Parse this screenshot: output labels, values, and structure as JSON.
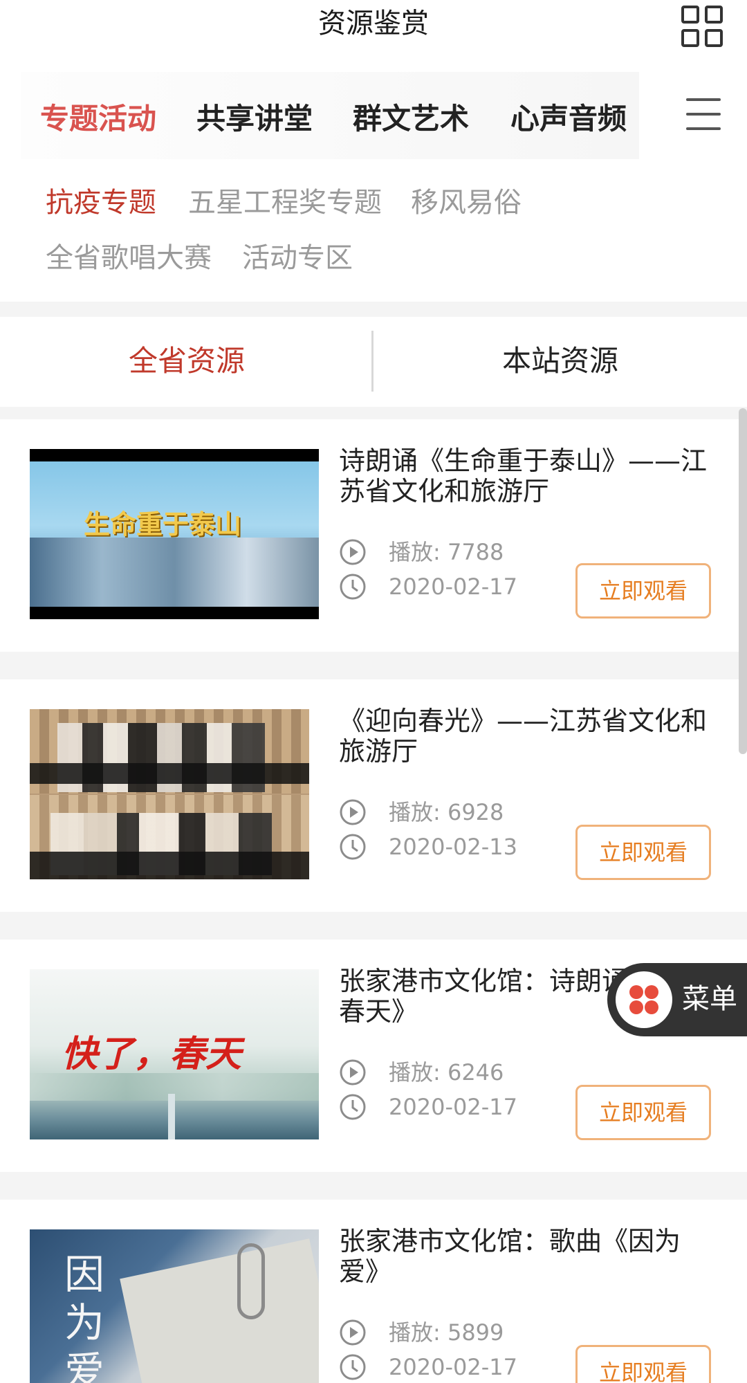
{
  "header": {
    "title": "资源鉴赏"
  },
  "main_tabs": [
    {
      "label": "专题活动",
      "active": true
    },
    {
      "label": "共享讲堂",
      "active": false
    },
    {
      "label": "群文艺术",
      "active": false
    },
    {
      "label": "心声音频",
      "active": false
    }
  ],
  "sub_tabs": [
    {
      "label": "抗疫专题",
      "active": true
    },
    {
      "label": "五星工程奖专题",
      "active": false
    },
    {
      "label": "移风易俗",
      "active": false
    },
    {
      "label": "全省歌唱大赛",
      "active": false
    },
    {
      "label": "活动专区",
      "active": false
    }
  ],
  "resource_toggle": {
    "province": "全省资源",
    "station": "本站资源"
  },
  "items": [
    {
      "title": "诗朗诵《生命重于泰山》——江苏省文化和旅游厅",
      "plays": "播放: 7788",
      "date": "2020-02-17",
      "button": "立即观看",
      "thumb_text": "生命重于泰山"
    },
    {
      "title": "《迎向春光》——江苏省文化和旅游厅",
      "plays": "播放: 6928",
      "date": "2020-02-13",
      "button": "立即观看"
    },
    {
      "title": "张家港市文化馆：诗朗诵《快了 春天》",
      "plays": "播放: 6246",
      "date": "2020-02-17",
      "button": "立即观看",
      "thumb_text": "快了，春天"
    },
    {
      "title": "张家港市文化馆：歌曲《因为爱》",
      "plays": "播放: 5899",
      "date": "2020-02-17",
      "button": "立即观看",
      "thumb_text": "因为爱"
    }
  ],
  "float_menu": {
    "label": "菜单"
  },
  "colors": {
    "active_red": "#c0392b",
    "button_orange": "#e67e22",
    "band_gray": "#f4f4f4"
  },
  "icons": {
    "grid": "grid-icon",
    "menu": "hamburger-icon",
    "play": "play-icon",
    "clock": "clock-icon"
  }
}
